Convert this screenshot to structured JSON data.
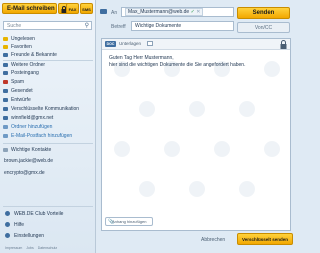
{
  "sidebar": {
    "compose_label": "E-Mail schreiben",
    "fax_label": "FAX",
    "sms_label": "SMS",
    "search_placeholder": "Suche",
    "folders": [
      {
        "label": "Ungelesen",
        "icon": "envelope-icon",
        "color": "#e8b400"
      },
      {
        "label": "Favoriten",
        "icon": "star-icon",
        "color": "#e8b400"
      },
      {
        "label": "Freunde & Bekannte",
        "icon": "people-icon",
        "color": "#3f6ea0"
      },
      {
        "label": "Weitere Ordner",
        "icon": "chevron-icon",
        "color": "#3f6ea0"
      },
      {
        "label": "Posteingang",
        "icon": "inbox-icon",
        "color": "#3f6ea0"
      },
      {
        "label": "Spam",
        "icon": "spam-icon",
        "color": "#c0392b"
      },
      {
        "label": "Gesendet",
        "icon": "sent-icon",
        "color": "#3f6ea0"
      },
      {
        "label": "Entwürfe",
        "icon": "draft-icon",
        "color": "#3f6ea0"
      },
      {
        "label": "Verschlüsselte Kommunikation",
        "icon": "lock-icon",
        "color": "#3f6ea0"
      },
      {
        "label": "winnfield@gmx.net",
        "icon": "mailbox-icon",
        "color": "#3f6ea0"
      },
      {
        "label": "Ordner hinzufügen",
        "icon": "plus-icon",
        "color": "#3f6ea0"
      },
      {
        "label": "E-Mail-Postfach hinzufügen",
        "icon": "plus-icon",
        "color": "#3f6ea0"
      }
    ],
    "contacts_heading": "Wichtige Kontakte",
    "contacts": [
      "brown.jackie@web.de",
      "encrypto@gmx.de"
    ],
    "bottom_items": [
      "WEB.DE Club Vorteile",
      "Hilfe",
      "Einstellungen"
    ],
    "footer_links": [
      "Impressum",
      "Jobs",
      "Datenschutz"
    ]
  },
  "compose": {
    "to_label": "An",
    "to_value": "Max_Mustermann@web.de",
    "subject_label": "Betreff",
    "subject_value": "Wichtige Dokumente",
    "send_label": "Senden",
    "cc_label": "Von/CC",
    "toolbar_label": "Unterlagen",
    "doc_chip": "DOC",
    "body_lines": [
      "Guten Tag Herr Mustermann,",
      "hier sind die wichtigen Dokumente die Sie angefordert haben."
    ],
    "attach_label": "Anhang hinzufügen",
    "abort_label": "Abbrechen",
    "encrypted_send_label": "Verschlüsselt senden"
  },
  "colors": {
    "accent": "#f5b800",
    "brand": "#3f6ea0",
    "background": "#dfeaf4"
  }
}
